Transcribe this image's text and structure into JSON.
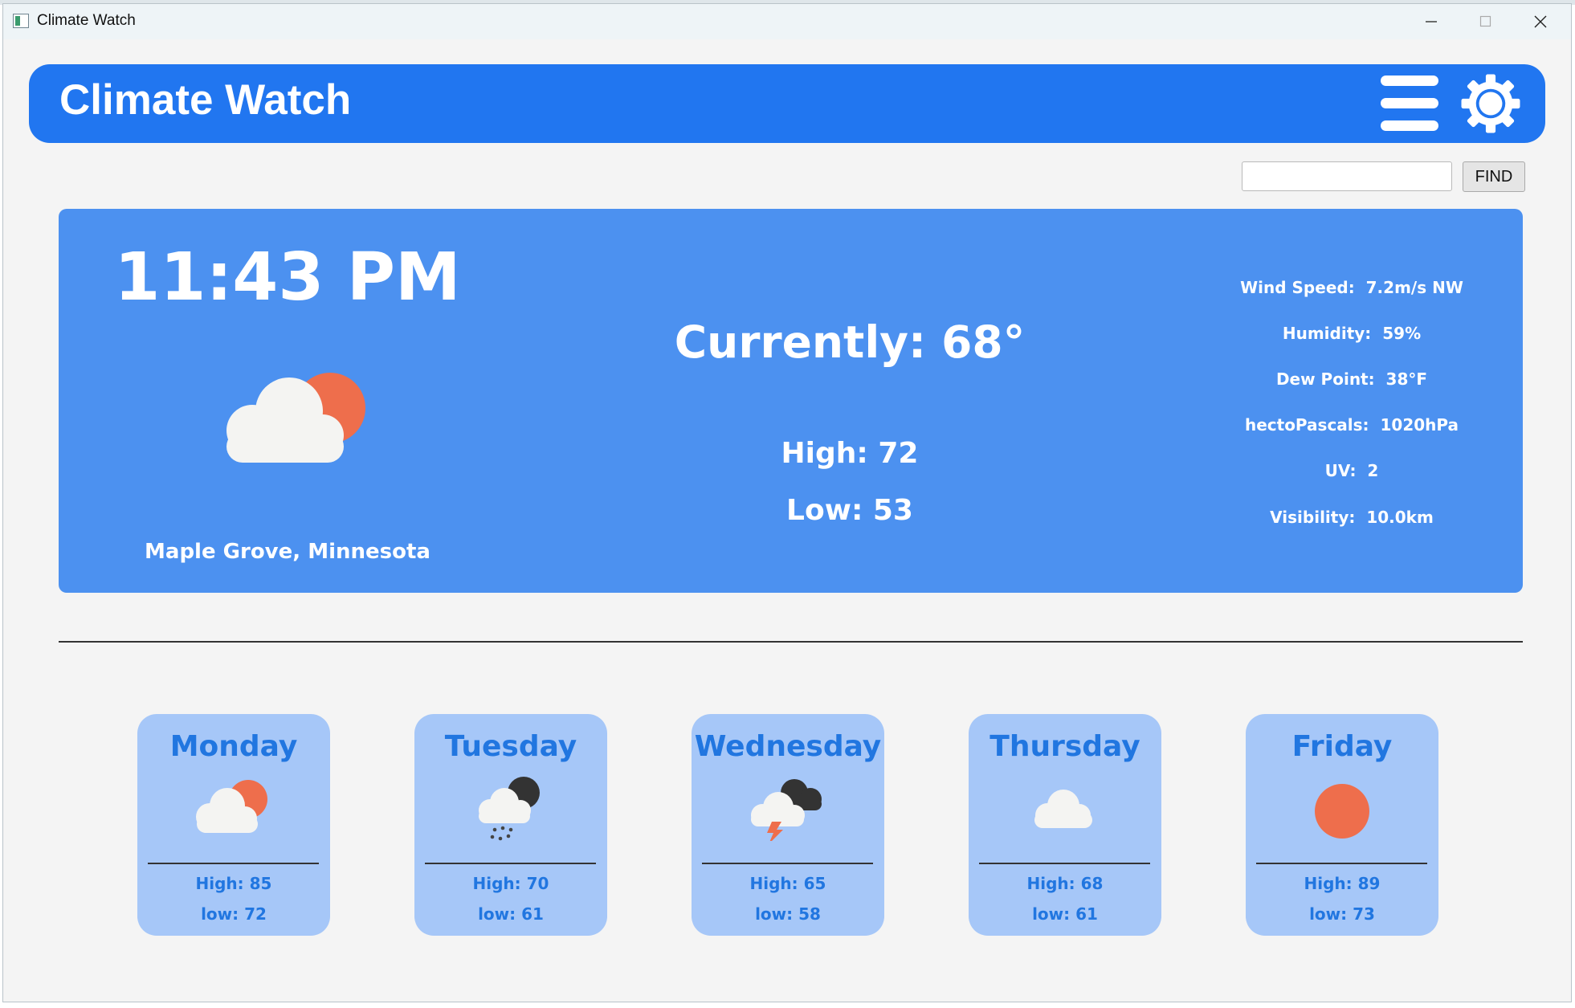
{
  "window": {
    "title": "Climate Watch",
    "icon": "app-window-icon",
    "controls": [
      "minimize-icon",
      "maximize-icon",
      "close-icon"
    ]
  },
  "header": {
    "title": "Climate Watch",
    "menu_icon": "hamburger-menu-icon",
    "settings_icon": "gear-icon",
    "background": "#2176f0"
  },
  "search": {
    "value": "",
    "placeholder": "",
    "button_label": "FIND"
  },
  "current": {
    "time": "11:43 PM",
    "icon": "partly-cloudy-icon",
    "location": "Maple Grove, Minnesota",
    "currently": "Currently: 68°",
    "high": "High: 72",
    "low": "Low: 53",
    "background": "#4c91f0",
    "details": [
      {
        "label": "Wind Speed:",
        "value": "7.2m/s NW"
      },
      {
        "label": "Humidity:",
        "value": "59%"
      },
      {
        "label": "Dew Point:",
        "value": "38°F"
      },
      {
        "label": "hectoPascals:",
        "value": "1020hPa"
      },
      {
        "label": "UV:",
        "value": "2"
      },
      {
        "label": "Visibility:",
        "value": "10.0km"
      }
    ]
  },
  "forecast": [
    {
      "day": "Monday",
      "icon": "partly-cloudy-icon",
      "high": "High: 85",
      "low": "low: 72"
    },
    {
      "day": "Tuesday",
      "icon": "rain-cloud-icon",
      "high": "High: 70",
      "low": "low: 61"
    },
    {
      "day": "Wednesday",
      "icon": "thunderstorm-icon",
      "high": "High: 65",
      "low": "low: 58"
    },
    {
      "day": "Thursday",
      "icon": "cloud-icon",
      "high": "High: 68",
      "low": "low: 61"
    },
    {
      "day": "Friday",
      "icon": "sun-icon",
      "high": "High: 89",
      "low": "low: 73"
    }
  ],
  "colors": {
    "card_background": "#a6c7f8",
    "card_text": "#2176e0",
    "sun": "#ee6e4c",
    "cloud": "#f4f4f2",
    "dark_cloud": "#333333"
  }
}
